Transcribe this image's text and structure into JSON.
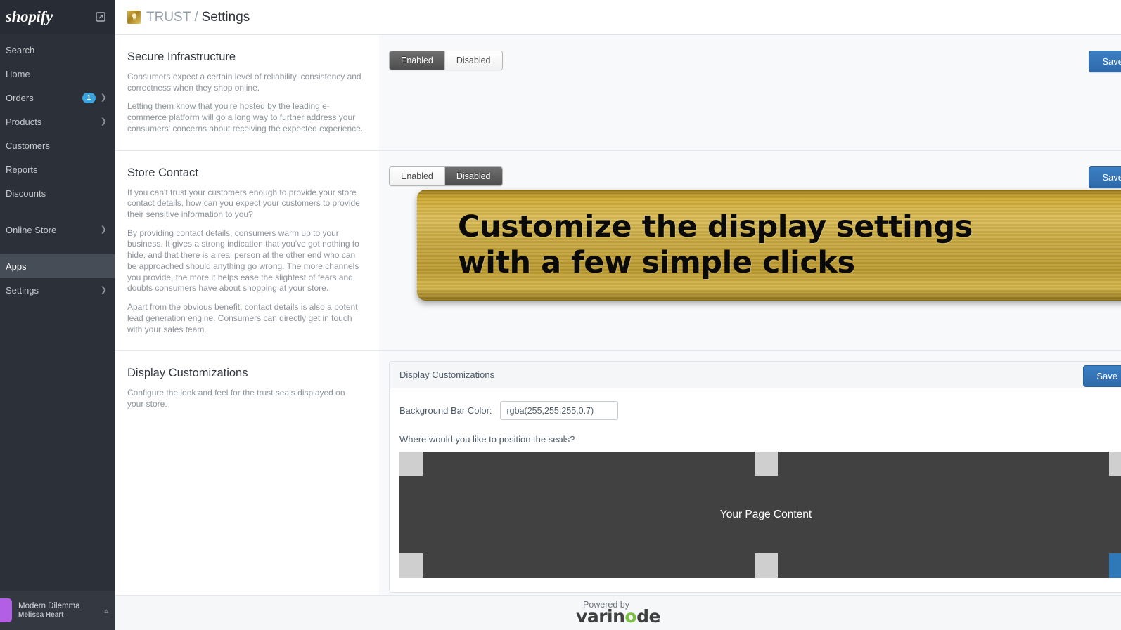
{
  "sidebar": {
    "logo": "shopify",
    "external_icon": "external-link-icon",
    "items": [
      {
        "label": "Search",
        "badge": null,
        "chevron": false,
        "active": false
      },
      {
        "label": "Home",
        "badge": null,
        "chevron": false,
        "active": false
      },
      {
        "label": "Orders",
        "badge": "1",
        "chevron": true,
        "active": false
      },
      {
        "label": "Products",
        "badge": null,
        "chevron": true,
        "active": false
      },
      {
        "label": "Customers",
        "badge": null,
        "chevron": false,
        "active": false
      },
      {
        "label": "Reports",
        "badge": null,
        "chevron": false,
        "active": false
      },
      {
        "label": "Discounts",
        "badge": null,
        "chevron": false,
        "active": false
      },
      {
        "label": "Online Store",
        "badge": null,
        "chevron": true,
        "active": false
      },
      {
        "label": "Apps",
        "badge": null,
        "chevron": false,
        "active": true
      },
      {
        "label": "Settings",
        "badge": null,
        "chevron": true,
        "active": false
      }
    ],
    "user": {
      "store": "Modern Dilemma",
      "name": "Melissa Heart",
      "caret": "chevron-up-icon"
    }
  },
  "header": {
    "app_icon": "trust-shield-icon",
    "app_name": "TRUST",
    "separator": "/",
    "page": "Settings"
  },
  "sections": {
    "secure_infrastructure": {
      "title": "Secure Infrastructure",
      "paragraphs": [
        "Consumers expect a certain level of reliability, consistency and correctness when they shop online.",
        "Letting them know that you're hosted by the leading e-commerce platform will go a long way to further address your consumers' concerns about receiving the expected experience."
      ],
      "toggle": {
        "enabled_label": "Enabled",
        "disabled_label": "Disabled",
        "selected": "Enabled"
      },
      "save_label": "Save"
    },
    "store_contact": {
      "title": "Store Contact",
      "paragraphs": [
        "If you can't trust your customers enough to provide your store contact details, how can you expect your customers to provide their sensitive information to you?",
        "By providing contact details, consumers warm up to your business. It gives a strong indication that you've got nothing to hide, and that there is a real person at the other end who can be approached should anything go wrong. The more channels you provide, the more it helps ease the slightest of fears and doubts consumers have about shopping at your store.",
        "Apart from the obvious benefit, contact details is also a potent lead generation engine. Consumers can directly get in touch with your sales team."
      ],
      "toggle": {
        "enabled_label": "Enabled",
        "disabled_label": "Disabled",
        "selected": "Disabled"
      },
      "save_label": "Save"
    },
    "banner": {
      "line1": "Customize the display settings",
      "line2": "with a few simple clicks"
    },
    "display_customizations": {
      "title": "Display Customizations",
      "paragraphs": [
        "Configure the look and feel for the trust seals displayed on your store."
      ],
      "card_title": "Display Customizations",
      "save_label": "Save",
      "bg_bar_color_label": "Background Bar Color:",
      "bg_bar_color_value": "rgba(255,255,255,0.7)",
      "position_question": "Where would you like to position the seals?",
      "stage_text": "Your Page Content",
      "positions": [
        {
          "name": "top-left",
          "selected": false
        },
        {
          "name": "top-center",
          "selected": false
        },
        {
          "name": "top-right",
          "selected": false
        },
        {
          "name": "bottom-left",
          "selected": false
        },
        {
          "name": "bottom-center",
          "selected": false
        },
        {
          "name": "bottom-right",
          "selected": true
        }
      ]
    }
  },
  "footer": {
    "powered_by": "Powered by",
    "brand_part1": "varin",
    "brand_o": "o",
    "brand_part2": "de"
  },
  "colors": {
    "sidebar_bg": "#2c3038",
    "accent_blue": "#3079b8",
    "badge_blue": "#3ba4e0",
    "gold": "#c2a33a",
    "stage_dark": "#414141",
    "brand_green": "#7ac143"
  }
}
